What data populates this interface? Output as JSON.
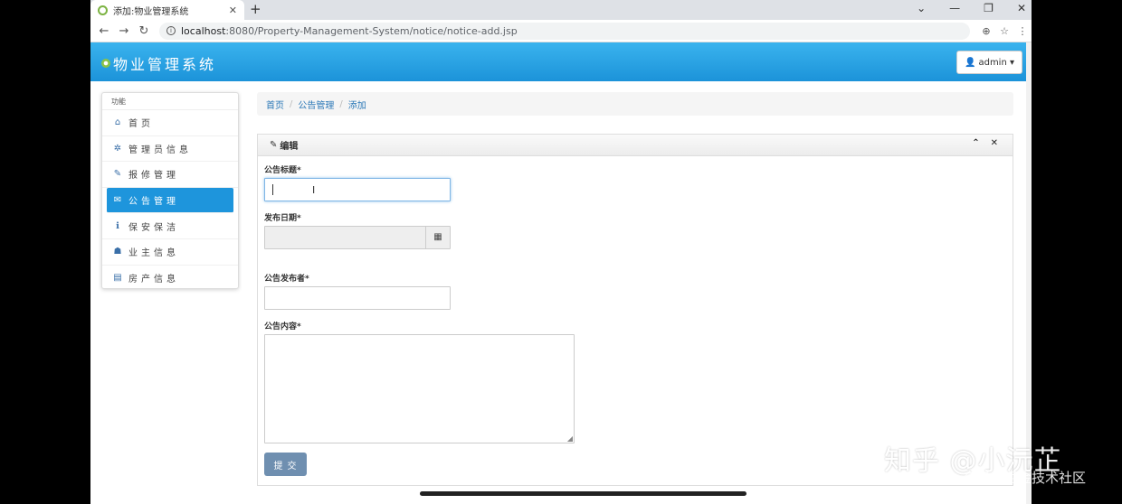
{
  "browser": {
    "tab_title": "添加:物业管理系统",
    "tab_close": "✕",
    "new_tab": "+",
    "url_host": "localhost",
    "url_path": ":8080/Property-Management-System/notice/notice-add.jsp",
    "window_controls": [
      "⌄",
      "—",
      "❐",
      "✕"
    ]
  },
  "app": {
    "brand": "物业管理系统",
    "user": "admin ▾"
  },
  "sidebar": {
    "heading": "功能",
    "items": [
      {
        "label": "首页",
        "icon": "⌂",
        "active": false
      },
      {
        "label": "管理员信息",
        "icon": "✲",
        "active": false
      },
      {
        "label": "报修管理",
        "icon": "✎",
        "active": false
      },
      {
        "label": "公告管理",
        "icon": "✉",
        "active": true
      },
      {
        "label": "保安保洁",
        "icon": "ℹ",
        "active": false
      },
      {
        "label": "业主信息",
        "icon": "☗",
        "active": false
      },
      {
        "label": "房产信息",
        "icon": "▤",
        "active": false
      }
    ]
  },
  "breadcrumb": {
    "items": [
      "首页",
      "公告管理",
      "添加"
    ],
    "separator": "/"
  },
  "panel": {
    "title": "编辑",
    "edit_icon": "✎",
    "collapse_icon": "⌃",
    "close_icon": "✕"
  },
  "form": {
    "title_label": "公告标题*",
    "date_label": "发布日期*",
    "publisher_label": "公告发布者*",
    "content_label": "公告内容*",
    "calendar_icon": "▦",
    "submit": "提交"
  },
  "watermark": {
    "line1": "知乎 @小沅芷",
    "line2": "@稀土掘金技术社区"
  },
  "colors": {
    "header_blue": "#1c93d9",
    "active_item": "#1e95dc",
    "submit": "#6f8fb0"
  }
}
